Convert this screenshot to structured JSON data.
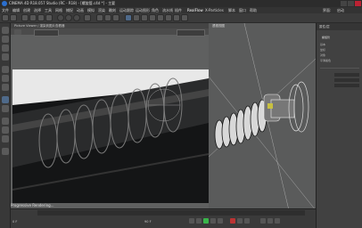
{
  "window": {
    "title": "CINEMA 4D R18.057 Studio (RC - R18) - [螺旋管.c4d *] - 主要"
  },
  "menu": [
    "文件",
    "编辑",
    "创建",
    "选择",
    "工具",
    "网格",
    "捕捉",
    "动画",
    "模拟",
    "渲染",
    "雕刻",
    "运动跟踪",
    "运动图形",
    "角色",
    "流水线",
    "插件",
    "RealFlow",
    "X-Particles",
    "脚本",
    "窗口",
    "帮助",
    "界面:",
    "启动"
  ],
  "render_window": {
    "title": "Picture Viewer / 渲染到图片查看器",
    "progress_text": "Progressive Rendering..."
  },
  "perspective": {
    "label": "透视视图"
  },
  "attributes": {
    "title": "属性/层",
    "rows": [
      "螺旋管",
      "基本",
      "坐标",
      "对象",
      "平滑着色"
    ]
  },
  "timeline": {
    "start": "0 F",
    "end": "90 F"
  },
  "colors": {
    "accent_play": "#39b54a",
    "logo": "#2a6fd0"
  }
}
